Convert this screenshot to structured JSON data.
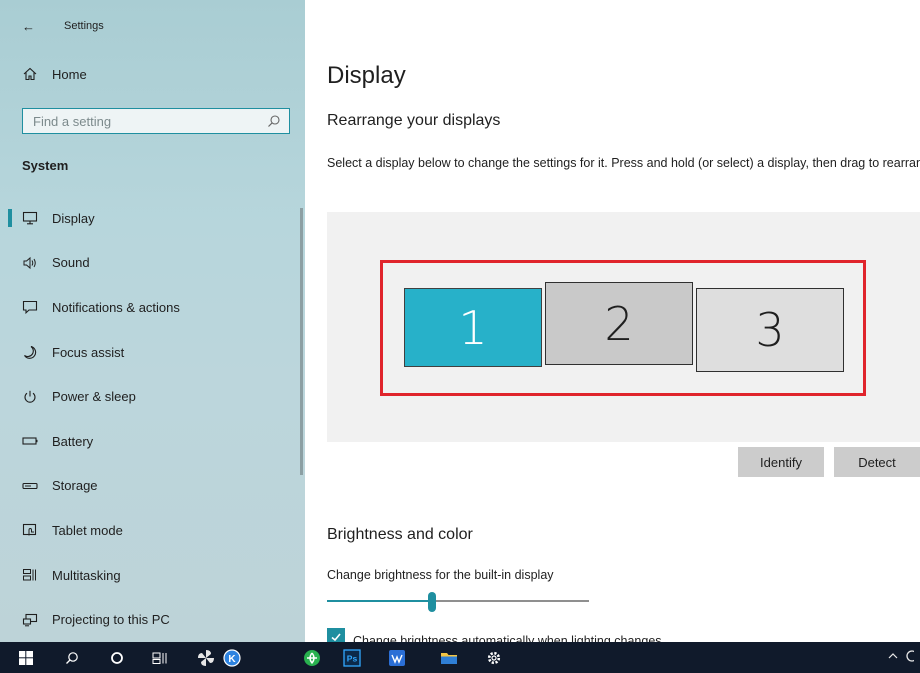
{
  "window": {
    "back_glyph": "←",
    "title": "Settings"
  },
  "sidebar": {
    "home_label": "Home",
    "search_placeholder": "Find a setting",
    "section": "System",
    "items": [
      {
        "label": "Display",
        "icon": "monitor-icon",
        "selected": true
      },
      {
        "label": "Sound",
        "icon": "speaker-icon"
      },
      {
        "label": "Notifications & actions",
        "icon": "notification-icon"
      },
      {
        "label": "Focus assist",
        "icon": "moon-icon"
      },
      {
        "label": "Power & sleep",
        "icon": "power-icon"
      },
      {
        "label": "Battery",
        "icon": "battery-icon"
      },
      {
        "label": "Storage",
        "icon": "storage-icon"
      },
      {
        "label": "Tablet mode",
        "icon": "tablet-mode-icon"
      },
      {
        "label": "Multitasking",
        "icon": "multitasking-icon"
      },
      {
        "label": "Projecting to this PC",
        "icon": "projecting-icon"
      }
    ]
  },
  "main": {
    "title": "Display",
    "rearrange_title": "Rearrange your displays",
    "rearrange_desc": "Select a display below to change the settings for it. Press and hold (or select) a display, then drag to rearrange it.",
    "monitors": [
      "1",
      "2",
      "3"
    ],
    "identify_label": "Identify",
    "detect_label": "Detect",
    "brightness_title": "Brightness and color",
    "brightness_label": "Change brightness for the built-in display",
    "brightness_value": 40,
    "auto_brightness_label": "Change brightness automatically when lighting changes",
    "auto_brightness_checked": true
  },
  "taskbar": {
    "icons": [
      "windows-start-icon",
      "search-icon",
      "cortana-icon",
      "task-view-icon",
      "pinwheel-app-icon",
      "k-app-icon",
      "browser-icon",
      "photoshop-icon",
      "edit-app-icon",
      "file-explorer-icon",
      "settings-gear-icon"
    ],
    "photoshop_text": "Ps",
    "k_text": "K"
  },
  "colors": {
    "accent": "#1f8fa0",
    "highlight_border": "#e0242c",
    "monitor_selected": "#27b1c9",
    "taskbar": "#101a2b"
  }
}
